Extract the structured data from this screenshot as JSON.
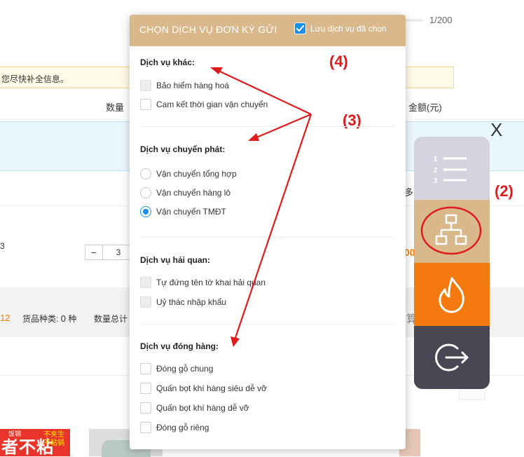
{
  "background": {
    "counter": "1/200",
    "notice": "您尽快补全信息。",
    "col_qty": "数量",
    "col_amount": "金额(元)",
    "frag_duo": "多",
    "frag_b": "3",
    "frag_orange": "00",
    "stepper": {
      "minus": "−",
      "value": "3"
    },
    "summary": {
      "count": "12",
      "kinds_label": "货品种类:",
      "kinds_value": "0",
      "kinds_unit": "种",
      "total_label": "数量总计",
      "settle_fragment": "算"
    },
    "thumb": {
      "top": "饭钢",
      "big": "者不粘",
      "small": "不夹生 不粘锅"
    },
    "close": "X",
    "more_dots": "⋮"
  },
  "toolbar": {
    "items": [
      {
        "icon": "ordered-list-icon",
        "color": "#d4d3df"
      },
      {
        "icon": "sitemap-icon",
        "color": "#d9b98c"
      },
      {
        "icon": "flame-icon",
        "color": "#f47a10"
      },
      {
        "icon": "logout-icon",
        "color": "#4a4754"
      }
    ]
  },
  "annotations": {
    "label_2": "(2)",
    "label_3": "(3)",
    "label_4": "(4)",
    "color": "#e01b1b"
  },
  "panel": {
    "title": "CHỌN DỊCH VỤ ĐƠN KÝ GỬI",
    "save_label": "Lưu dịch vụ đã chọn",
    "save_checked": true,
    "sections": {
      "other": {
        "title": "Dịch vụ khác:",
        "options": [
          "Bảo hiểm hàng hoá",
          "Cam kết thời gian vận chuyển"
        ]
      },
      "shipping": {
        "title": "Dịch vụ chuyển phát:",
        "options": [
          "Vận chuyển tổng hợp",
          "Vận chuyển hàng lô",
          "Vận chuyển TMĐT"
        ],
        "selected": "Vận chuyển TMĐT"
      },
      "customs": {
        "title": "Dịch vụ hải quan:",
        "options": [
          "Tự đứng tên tờ khai hải quan",
          "Uỷ thác nhập khẩu"
        ]
      },
      "packing": {
        "title": "Dịch vụ đóng hàng:",
        "options": [
          "Đóng gỗ chung",
          "Quấn bọt khí hàng siêu dễ vỡ",
          "Quấn bọt khí hàng dễ vỡ",
          "Đóng gỗ riêng"
        ]
      }
    }
  },
  "colors": {
    "accent_tan": "#d9b98c",
    "accent_blue": "#1a8fe8",
    "accent_orange": "#f47a10"
  }
}
